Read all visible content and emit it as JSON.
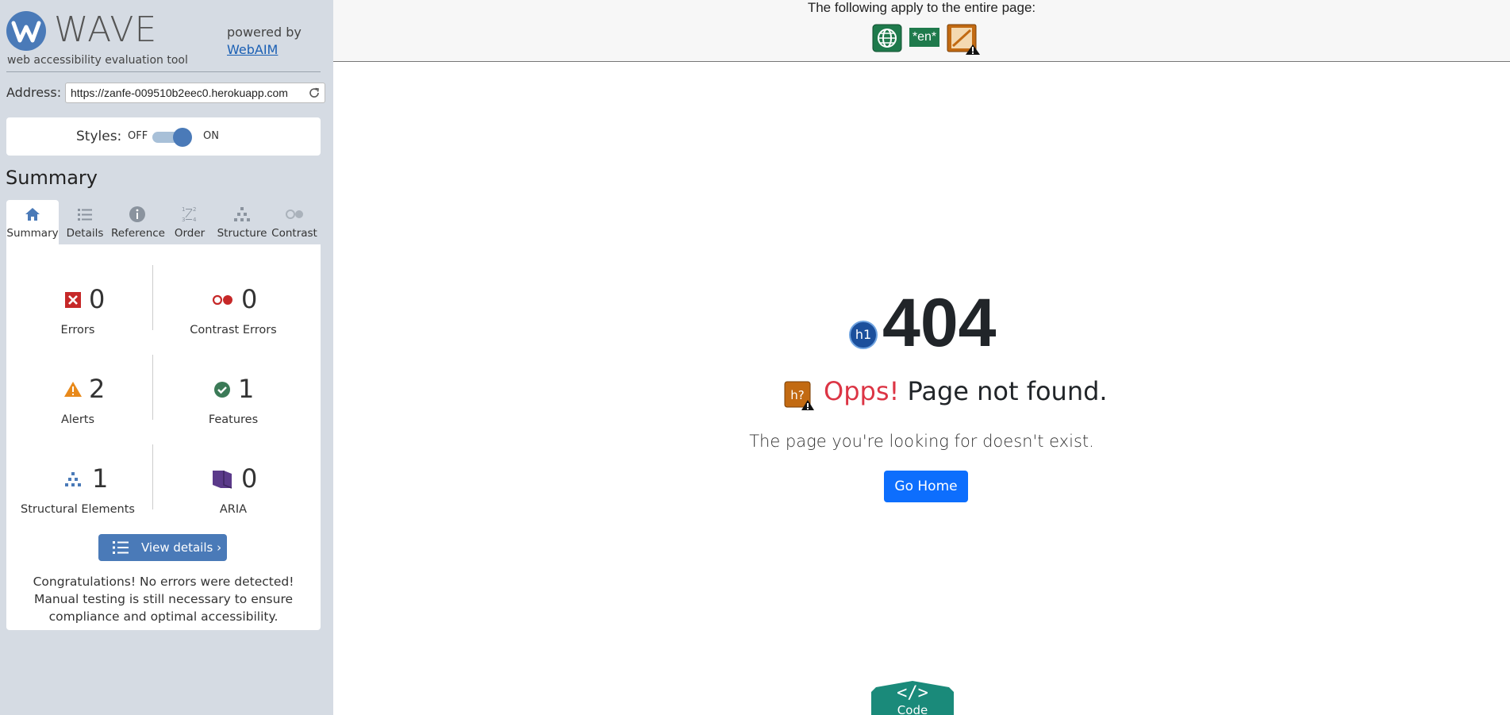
{
  "sidebar": {
    "logo_word": "WAVE",
    "tagline": "web accessibility evaluation tool",
    "powered_by": "powered by",
    "webaim_link": "WebAIM",
    "address_label": "Address:",
    "address_value": "https://zanfe-009510b2eec0.herokuapp.com",
    "styles_label": "Styles:",
    "styles_off": "OFF",
    "styles_on": "ON",
    "styles_enabled": true,
    "summary_heading": "Summary",
    "tabs": [
      {
        "label": "Summary",
        "icon": "home-icon",
        "active": true
      },
      {
        "label": "Details",
        "icon": "list-icon",
        "active": false
      },
      {
        "label": "Reference",
        "icon": "info-icon",
        "active": false
      },
      {
        "label": "Order",
        "icon": "order-icon",
        "active": false
      },
      {
        "label": "Structure",
        "icon": "structure-icon",
        "active": false
      },
      {
        "label": "Contrast",
        "icon": "contrast-icon",
        "active": false
      }
    ],
    "stats": {
      "errors": {
        "count": "0",
        "label": "Errors"
      },
      "contrast_errors": {
        "count": "0",
        "label": "Contrast Errors"
      },
      "alerts": {
        "count": "2",
        "label": "Alerts"
      },
      "features": {
        "count": "1",
        "label": "Features"
      },
      "structural": {
        "count": "1",
        "label": "Structural Elements"
      },
      "aria": {
        "count": "0",
        "label": "ARIA"
      }
    },
    "view_details": "View details ›",
    "congrats": "Congratulations! No errors were detected! Manual testing is still necessary to ensure compliance and optimal accessibility."
  },
  "main": {
    "banner_text": "The following apply to the entire page:",
    "banner_lang": "*en*",
    "h1_badge": "h1",
    "heading": "404",
    "hq_badge": "h?",
    "opps": "Opps!",
    "not_found": " Page not found.",
    "subtext": "The page you're looking for doesn't exist.",
    "go_home": "Go Home",
    "code_tab": "Code"
  },
  "colors": {
    "sidebar_bg": "#d5dbe3",
    "wave_blue": "#4a7ab8",
    "error_red": "#c62828",
    "alert_orange": "#e8891a",
    "feature_green": "#3b7a57",
    "aria_purple": "#5b3a8a",
    "bootstrap_primary": "#0d6efd",
    "danger": "#dc3545",
    "code_teal": "#1a8a7a"
  }
}
